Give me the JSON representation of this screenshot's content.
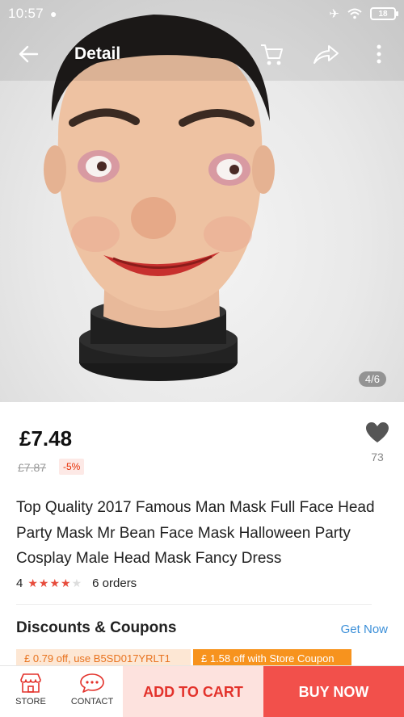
{
  "status_bar": {
    "time": "10:57",
    "battery": "18"
  },
  "header": {
    "title": "Detail"
  },
  "gallery": {
    "counter": "4/6"
  },
  "product": {
    "price": "£7.48",
    "old_price": "£7.87",
    "discount": "-5%",
    "wishlist_count": "73",
    "title": "Top Quality 2017 Famous Man Mask Full Face Head Party Mask Mr Bean Face Mask Halloween Party Cosplay Male Head Mask Fancy Dress",
    "rating": "4",
    "rating_stars": 4,
    "orders": "6 orders"
  },
  "coupons": {
    "section_title": "Discounts & Coupons",
    "get_now": "Get Now",
    "items": [
      "£ 0.79 off, use B5SD017YRLT1",
      "£ 1.58 off with Store Coupon"
    ]
  },
  "bottom_bar": {
    "store_label": "STORE",
    "contact_label": "CONTACT",
    "add_to_cart": "ADD TO CART",
    "buy_now": "BUY NOW"
  },
  "colors": {
    "accent_red": "#f2504b",
    "add_cart_bg": "#fde2de",
    "link_blue": "#3b8fd8",
    "coupon_orange": "#f7931e"
  }
}
